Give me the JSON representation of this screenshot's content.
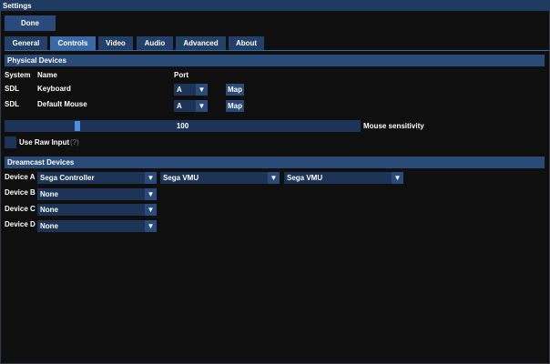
{
  "window": {
    "title": "Settings"
  },
  "done_label": "Done",
  "tabs": [
    {
      "label": "General"
    },
    {
      "label": "Controls"
    },
    {
      "label": "Video"
    },
    {
      "label": "Audio"
    },
    {
      "label": "Advanced"
    },
    {
      "label": "About"
    }
  ],
  "active_tab": "Controls",
  "physical": {
    "header": "Physical Devices",
    "columns": {
      "system": "System",
      "name": "Name",
      "port": "Port"
    },
    "rows": [
      {
        "system": "SDL",
        "name": "Keyboard",
        "port": "A",
        "map": "Map"
      },
      {
        "system": "SDL",
        "name": "Default Mouse",
        "port": "A",
        "map": "Map"
      }
    ]
  },
  "sensitivity": {
    "value": "100",
    "label": "Mouse sensitivity",
    "fraction": 0.2
  },
  "raw_input": {
    "label": "Use Raw Input",
    "help": "(?)",
    "checked": false
  },
  "dreamcast": {
    "header": "Dreamcast Devices",
    "devices": [
      {
        "label": "Device A",
        "main": "Sega Controller",
        "slot1": "Sega VMU",
        "slot2": "Sega VMU"
      },
      {
        "label": "Device B",
        "main": "None"
      },
      {
        "label": "Device C",
        "main": "None"
      },
      {
        "label": "Device D",
        "main": "None"
      }
    ]
  },
  "arrow": "▼"
}
